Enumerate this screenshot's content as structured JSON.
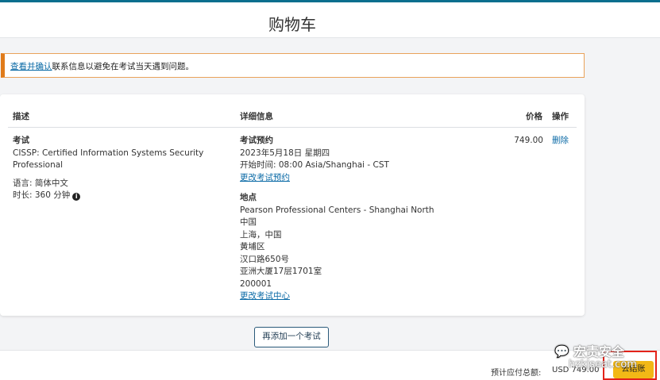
{
  "header": {
    "title": "购物车"
  },
  "alert": {
    "link_text": "查看并确认",
    "message": "联系信息以避免在考试当天遇到问题。"
  },
  "table": {
    "headers": {
      "description": "描述",
      "details": "详细信息",
      "price": "价格",
      "actions": "操作"
    },
    "row": {
      "exam_label": "考试",
      "exam_name_line1": "CISSP: Certified Information Systems Security",
      "exam_name_line2": "Professional",
      "language": "语言: 简体中文",
      "duration": "时长: 360 分钟",
      "appointment_title": "考试预约",
      "appointment_date": "2023年5月18日 星期四",
      "appointment_time": "开始时间:  08:00 Asia/Shanghai - CST",
      "change_appointment": "更改考试预约",
      "location_title": "地点",
      "location_lines": [
        "Pearson Professional Centers - Shanghai North",
        "中国",
        "上海，中国",
        "黄埔区",
        "汉口路650号",
        "亚洲大厦17层1701室",
        "200001"
      ],
      "change_center": "更改考试中心",
      "price": "749.00",
      "delete": "删除"
    }
  },
  "add_exam_button": "再添加一个考试",
  "footer": {
    "total_label": "预计应付总额:",
    "total_value": "USD 749.00",
    "checkout_button": "去结账"
  },
  "watermark": {
    "name": "宏责安全",
    "site": "hzkjseat.com",
    "icon": "wechat-icon"
  },
  "colors": {
    "accent": "#0a6e8e",
    "alert_border": "#e07b1a",
    "checkout": "#f2b816",
    "highlight": "#e3231a",
    "link": "#0a6aa6"
  }
}
